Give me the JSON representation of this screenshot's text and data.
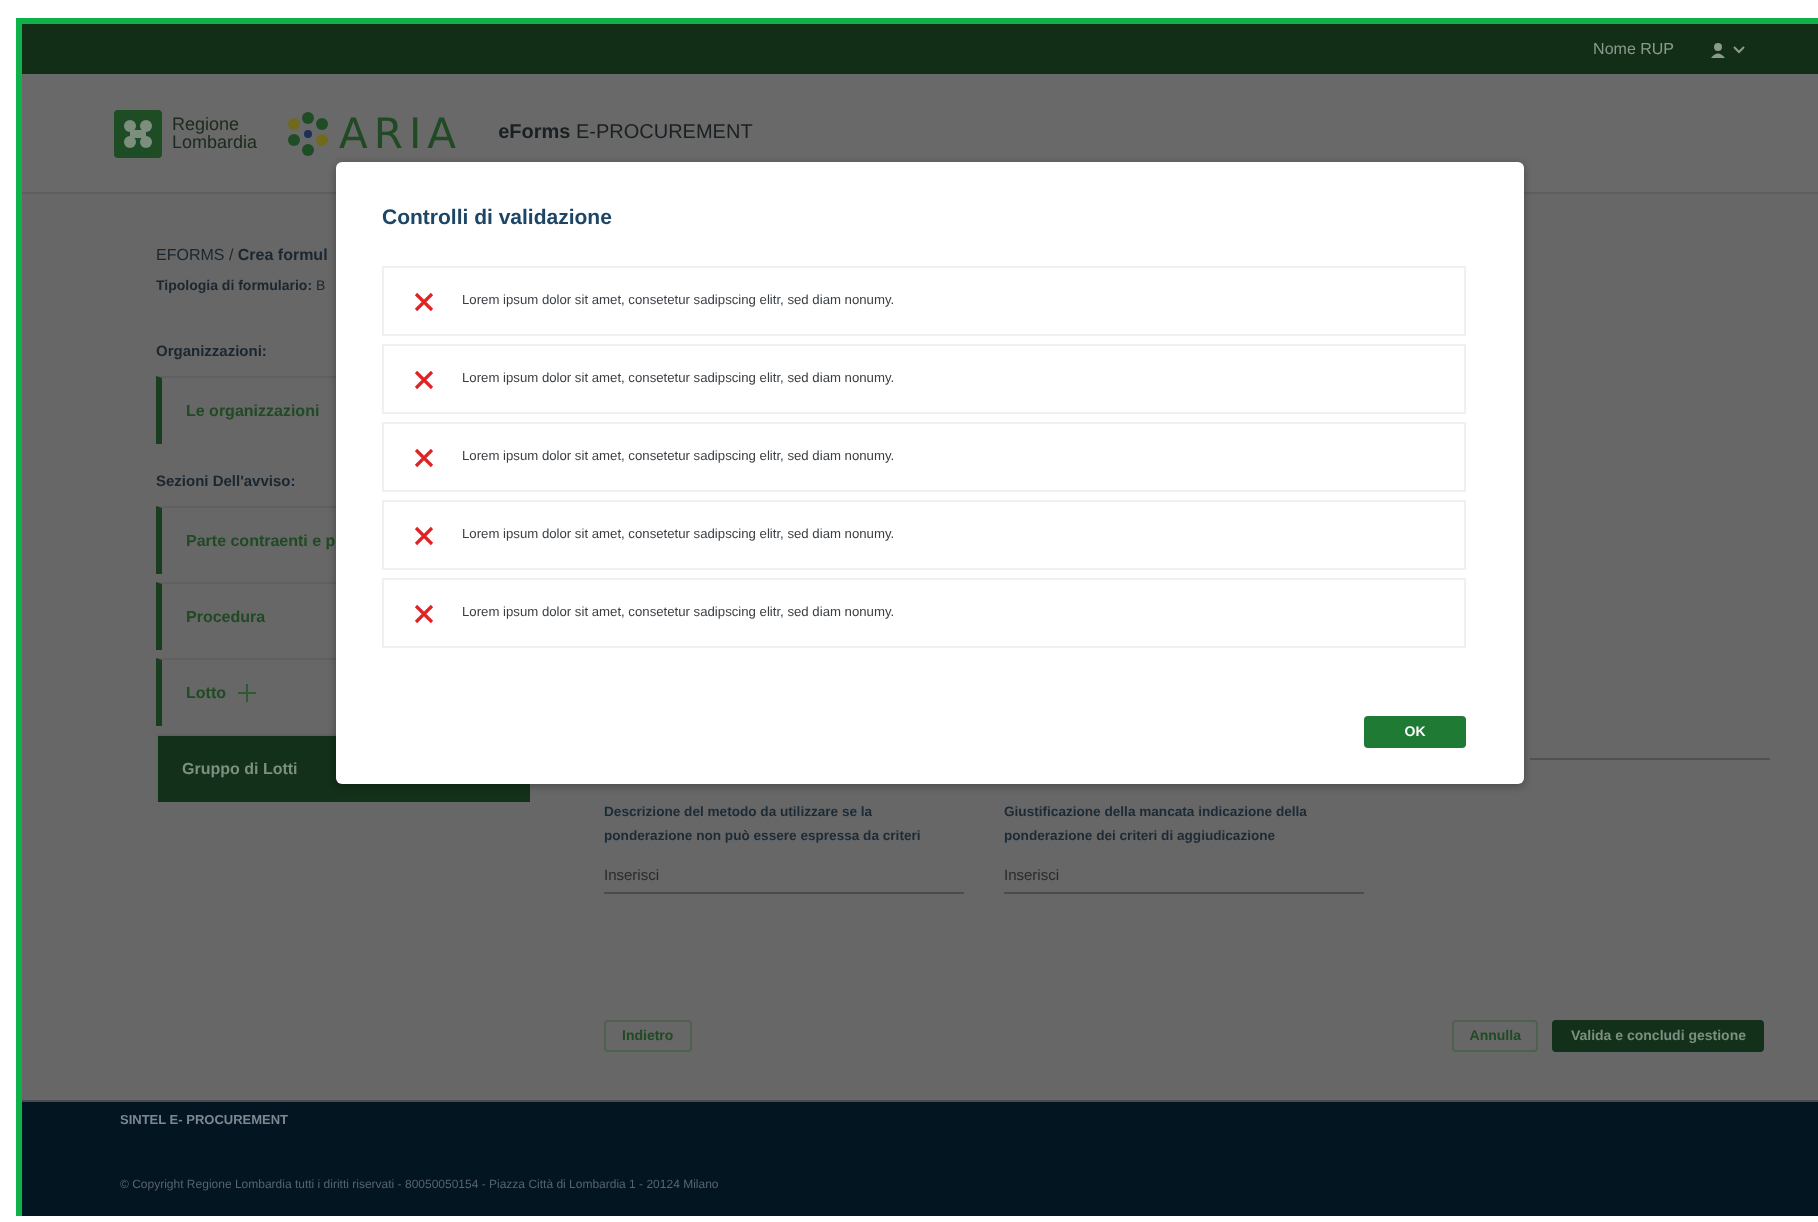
{
  "topbar": {
    "user_name": "Nome RUP"
  },
  "header": {
    "region_lines": [
      "Regione",
      "Lombardia"
    ],
    "agency": "ARIA",
    "app_title": "**eForms** E-PROCUREMENT"
  },
  "breadcrumb": "EFORMS / **Crea formul**",
  "form_type": "**Tipologia di formulario:**  B",
  "sidebar": {
    "sections": [
      {
        "heading": "Organizzazioni:",
        "items": [
          {
            "label": "Le organizzazioni",
            "selected": false,
            "addable": false
          }
        ]
      },
      {
        "heading": "Sezioni Dell'avviso:",
        "items": [
          {
            "label": "Parte contraenti e p",
            "selected": false,
            "addable": false
          },
          {
            "label": "Procedura",
            "selected": false,
            "addable": false
          },
          {
            "label": "Lotto",
            "selected": false,
            "addable": true
          },
          {
            "label": "Gruppo di Lotti",
            "selected": true,
            "addable": false
          }
        ]
      }
    ]
  },
  "fields": [
    {
      "label": "Descrizione del metodo da utilizzare se la ponderazione non può essere espressa da criteri",
      "placeholder": "Inserisci"
    },
    {
      "label": "Giustificazione della mancata indicazione della ponderazione dei criteri di aggiudicazione",
      "placeholder": "Inserisci"
    }
  ],
  "actions_left": [
    {
      "label": "Indietro",
      "kind": "outline"
    }
  ],
  "actions_right": [
    {
      "label": "Annulla",
      "kind": "outline"
    },
    {
      "label": "Valida e concludi gestione",
      "kind": "primary"
    }
  ],
  "dialog": {
    "title": "Controlli di validazione",
    "messages": [
      {
        "text": "Lorem ipsum dolor sit amet, consetetur sadipscing elitr, sed diam nonumy."
      },
      {
        "text": "Lorem ipsum dolor sit amet, consetetur sadipscing elitr, sed diam nonumy."
      },
      {
        "text": "Lorem ipsum dolor sit amet, consetetur sadipscing elitr, sed diam nonumy."
      },
      {
        "text": "Lorem ipsum dolor sit amet, consetetur sadipscing elitr, sed diam nonumy."
      },
      {
        "text": "Lorem ipsum dolor sit amet, consetetur sadipscing elitr, sed diam nonumy."
      }
    ],
    "buttons": [
      {
        "label": "OK",
        "kind": "primary"
      }
    ]
  },
  "footer": {
    "title": "SINTEL E- PROCUREMENT",
    "copyright": "© Copyright Regione Lombardia tutti i diritti riservati - 80050050154 - Piazza Città di Lombardia 1 - 20124 Milano"
  }
}
